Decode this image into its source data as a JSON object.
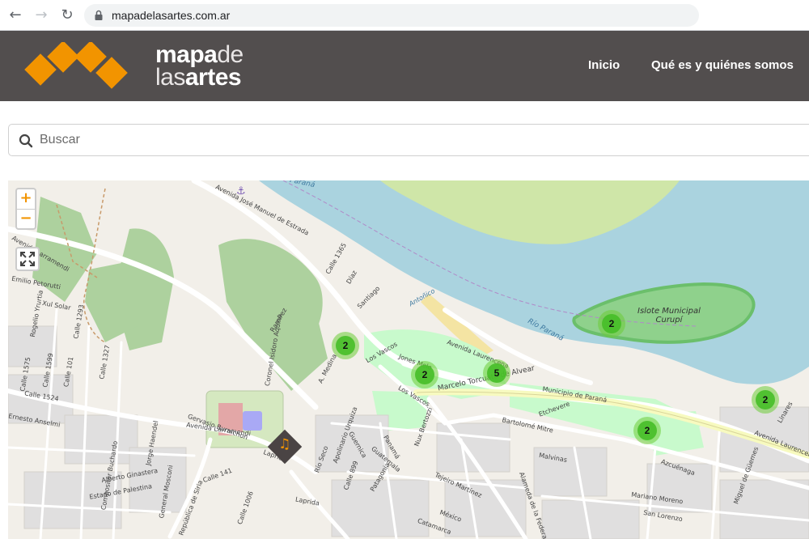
{
  "browser": {
    "url": "mapadelasartes.com.ar",
    "back_icon": "arrow-left",
    "forward_icon": "arrow-right",
    "reload_icon": "reload"
  },
  "header": {
    "logo_top": "mapa",
    "logo_top_thin": "de",
    "logo_bottom_thin": "las",
    "logo_bottom": "artes",
    "menu": [
      {
        "label": "Inicio"
      },
      {
        "label": "Qué es y quiénes somos"
      }
    ],
    "colors": {
      "background": "#524e4e",
      "accent": "#f29400"
    }
  },
  "search": {
    "placeholder": "Buscar",
    "value": ""
  },
  "map": {
    "zoom_in": "+",
    "zoom_out": "−",
    "clusters": [
      {
        "count": "2"
      },
      {
        "count": "2"
      },
      {
        "count": "5"
      },
      {
        "count": "2"
      },
      {
        "count": "2"
      },
      {
        "count": "2"
      }
    ],
    "labels": {
      "river": "Río Paraná",
      "river_top": "Paraná",
      "island_1": "Islote Municipal",
      "island_2": "Curupí",
      "av_estrada": "Avenida José Manuel de Estrada",
      "av_laurencena": "Avenida Laurencena",
      "marcelo": "Marcelo Torcuato de Alvear",
      "municipio": "Municipio de Paraná",
      "los_vascos": "Los Vascos",
      "los_vascos_2": "Los Vascos",
      "bartolome": "Bartolomé Mitre",
      "larramendi": "Avenida Larramendi",
      "larramendi_2": "Avenida Larramendi",
      "mariano": "Mariano Moreno",
      "medina": "A. Medina",
      "coronel": "Coronel Isidoro Aquino",
      "ramirez": "Ramírez",
      "antofico": "Antoñico",
      "santiago": "Santiago",
      "diaz": "Díaz",
      "calle1365": "Calle 1365",
      "etchevere": "Etchevere",
      "malvinas": "Malvinas",
      "azcuenaga": "Azcuénaga",
      "linares": "Linares",
      "laprida": "Laprida",
      "laprida_2": "Laprida",
      "alameda": "Alameda de la Federación",
      "tejeiro": "Tejeiro Martínez",
      "mexico": "México",
      "catamarca": "Catamarca",
      "guemes": "Miguel de Güemes",
      "san_lorenzo": "San Lorenzo",
      "nux": "Nux Bertozzi",
      "jones": "Jones Melo",
      "guernica": "Guernica",
      "republica_siria": "República de Siria",
      "gervasio": "Gervasio Burnichon",
      "calle141": "Calle 141",
      "calle1006": "Calle 1006",
      "estado_palestina": "Estado de Palestina",
      "alberto": "Alberto Ginastera",
      "general_mosconi": "General Mosconi",
      "compositor": "Compositor Buchardo",
      "jorge": "Jorge Haendel",
      "calle1524": "Calle 1524",
      "ernesto": "Ernesto Anselmi",
      "emilio": "Emilio Petorutti",
      "xul": "Xul Solar",
      "rogelio": "Rogelio Yrurtia",
      "calle1293": "Calle 1293",
      "calle1327": "Calle 1327",
      "calle1599": "Calle 1599",
      "calle1575": "Calle 1575",
      "calle101": "Calle 101",
      "calle899": "Calle 899",
      "guatemala": "Guatemala",
      "patagonia": "Patagonia",
      "panama": "Panamá",
      "rio_seco": "Río Seco",
      "apolinario": "Apolinario Urquiza"
    }
  }
}
